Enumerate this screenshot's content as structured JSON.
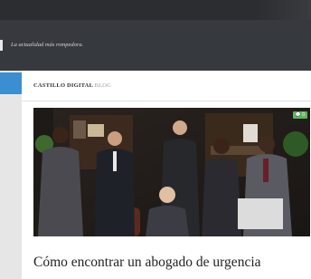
{
  "header": {
    "tagline": "La actualidad más rompedora."
  },
  "blog": {
    "name_primary": "CASTILLO DIGITAL",
    "name_secondary": "BLOG"
  },
  "post": {
    "comment_count": "0",
    "title": "Cómo encontrar un abogado de urgencia"
  },
  "colors": {
    "sidebar_accent": "#3b8fd0",
    "badge": "#5cb85c"
  },
  "icons": {
    "comments": "speech-bubble-icon"
  }
}
